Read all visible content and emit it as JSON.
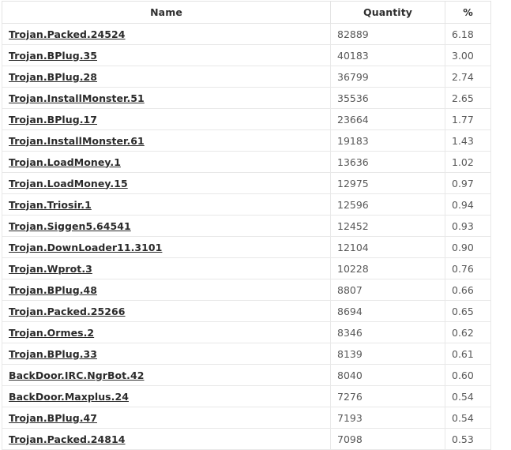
{
  "table": {
    "columns": [
      {
        "key": "name",
        "label": "Name",
        "align": "center"
      },
      {
        "key": "quantity",
        "label": "Quantity",
        "align": "center"
      },
      {
        "key": "percent",
        "label": "%",
        "align": "center"
      }
    ],
    "rows": [
      {
        "name": "Trojan.Packed.24524",
        "quantity": "82889",
        "percent": "6.18"
      },
      {
        "name": "Trojan.BPlug.35",
        "quantity": "40183",
        "percent": "3.00"
      },
      {
        "name": "Trojan.BPlug.28",
        "quantity": "36799",
        "percent": "2.74"
      },
      {
        "name": "Trojan.InstallMonster.51",
        "quantity": "35536",
        "percent": "2.65"
      },
      {
        "name": "Trojan.BPlug.17",
        "quantity": "23664",
        "percent": "1.77"
      },
      {
        "name": "Trojan.InstallMonster.61",
        "quantity": "19183",
        "percent": "1.43"
      },
      {
        "name": "Trojan.LoadMoney.1",
        "quantity": "13636",
        "percent": "1.02"
      },
      {
        "name": "Trojan.LoadMoney.15",
        "quantity": "12975",
        "percent": "0.97"
      },
      {
        "name": "Trojan.Triosir.1",
        "quantity": "12596",
        "percent": "0.94"
      },
      {
        "name": "Trojan.Siggen5.64541",
        "quantity": "12452",
        "percent": "0.93"
      },
      {
        "name": "Trojan.DownLoader11.3101",
        "quantity": "12104",
        "percent": "0.90"
      },
      {
        "name": "Trojan.Wprot.3",
        "quantity": "10228",
        "percent": "0.76"
      },
      {
        "name": "Trojan.BPlug.48",
        "quantity": "8807",
        "percent": "0.66"
      },
      {
        "name": "Trojan.Packed.25266",
        "quantity": "8694",
        "percent": "0.65"
      },
      {
        "name": "Trojan.Ormes.2",
        "quantity": "8346",
        "percent": "0.62"
      },
      {
        "name": "Trojan.BPlug.33",
        "quantity": "8139",
        "percent": "0.61"
      },
      {
        "name": "BackDoor.IRC.NgrBot.42",
        "quantity": "8040",
        "percent": "0.60"
      },
      {
        "name": "BackDoor.Maxplus.24",
        "quantity": "7276",
        "percent": "0.54"
      },
      {
        "name": "Trojan.BPlug.47",
        "quantity": "7193",
        "percent": "0.54"
      },
      {
        "name": "Trojan.Packed.24814",
        "quantity": "7098",
        "percent": "0.53"
      }
    ]
  },
  "colors": {
    "border": "#e8e8e8",
    "header_border": "#e3e3e3",
    "link_text": "#2b2b2b",
    "value_text": "#5c5c5c",
    "header_text": "#2f2f2f",
    "background": "#ffffff"
  }
}
